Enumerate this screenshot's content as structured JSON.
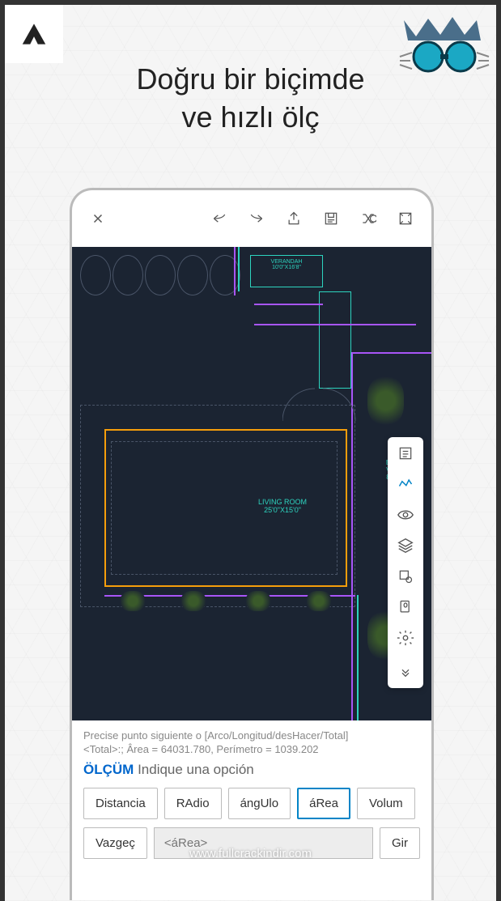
{
  "logo": "A",
  "headline_line1": "Doğru bir biçimde",
  "headline_line2": "ve hızlı ölç",
  "canvas_labels": {
    "verandah": "VERANDAH",
    "verandah_dim": "10'0\"X16'8\"",
    "living_room": "LIVING ROOM",
    "living_room_dim": "25'0\"X15'0\"",
    "entrance": "EN\nVE\n8'0"
  },
  "command_prompt": {
    "line1": "Precise punto siguiente o [Arco/Longitud/desHacer/Total]",
    "line2": "<Total>:; Ârea = 64031.780, Perímetro = 1039.202",
    "olcum_label": "ÖLÇÜM",
    "olcum_text": "Indique una opción"
  },
  "options": [
    "Distancia",
    "RAdio",
    "ángUlo",
    "áRea",
    "Volum"
  ],
  "selected_option": "áRea",
  "bottom_buttons": {
    "cancel": "Vazgeç",
    "input_placeholder": "<áRea>",
    "go": "Gir"
  },
  "watermark": "www.fullcrackindir.com"
}
